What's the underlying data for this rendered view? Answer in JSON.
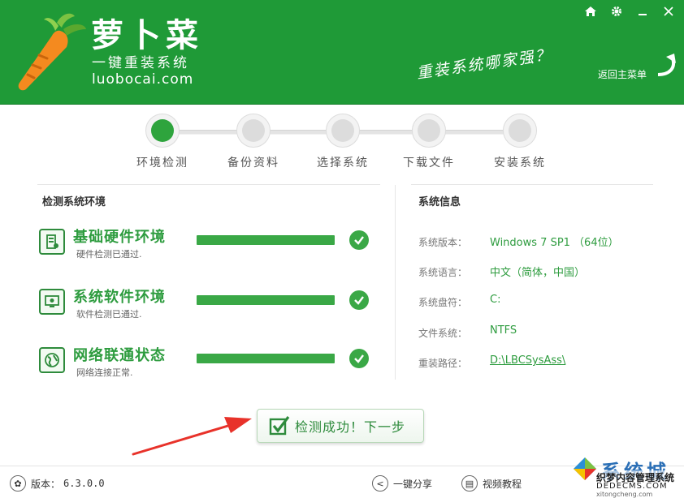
{
  "colors": {
    "brand": "#1f9a37",
    "accent": "#2e9c3f",
    "arrow": "#e8322a"
  },
  "header": {
    "brand_name": "萝卜菜",
    "slogan": "一键重装系统",
    "url": "luobocai.com",
    "tagline": "重装系统哪家强？",
    "back_label": "返回主菜单",
    "icons": {
      "home": "home-icon",
      "settings": "gear-icon",
      "minimize": "minimize-icon",
      "close": "close-icon"
    }
  },
  "steps": [
    {
      "label": "环境检测",
      "active": true
    },
    {
      "label": "备份资料",
      "active": false
    },
    {
      "label": "选择系统",
      "active": false
    },
    {
      "label": "下载文件",
      "active": false
    },
    {
      "label": "安装系统",
      "active": false
    }
  ],
  "left_panel": {
    "title": "检测系统环境",
    "checks": [
      {
        "title": "基础硬件环境",
        "sub": "硬件检测已通过.",
        "progress": 1.0,
        "icon": "hardware-icon"
      },
      {
        "title": "系统软件环境",
        "sub": "软件检测已通过.",
        "progress": 1.0,
        "icon": "monitor-icon"
      },
      {
        "title": "网络联通状态",
        "sub": "网络连接正常.",
        "progress": 1.0,
        "icon": "globe-icon"
      }
    ]
  },
  "right_panel": {
    "title": "系统信息",
    "rows": [
      {
        "key": "系统版本：",
        "value": "Windows 7 SP1 （64位）"
      },
      {
        "key": "系统语言：",
        "value": "中文（简体，中国）"
      },
      {
        "key": "系统盘符：",
        "value": "C:"
      },
      {
        "key": "文件系统：",
        "value": "NTFS"
      },
      {
        "key": "重装路径：",
        "value": "D:\\LBCSysAss\\"
      }
    ]
  },
  "next_button": {
    "label": "检测成功！下一步"
  },
  "footer": {
    "version_label": "版本：",
    "version": "6.3.0.0",
    "share_label": "一键分享",
    "video_label": "视频教程"
  },
  "watermark": {
    "cn": "系统城",
    "sub": "织梦内容管理系统",
    "en": "DEDECMS.COM",
    "url": "xitongcheng.com"
  }
}
